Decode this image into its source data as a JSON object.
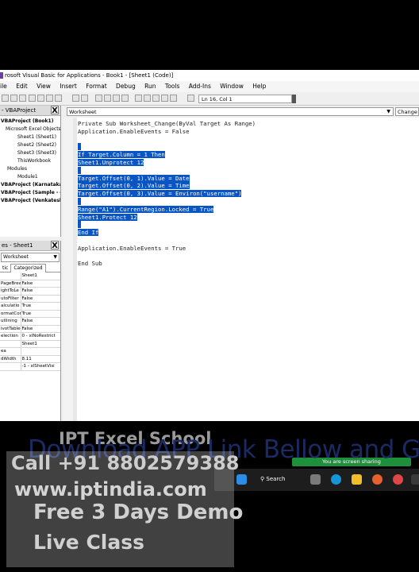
{
  "window": {
    "title": "rosoft Visual Basic for Applications - Book1 - [Sheet1 (Code)]",
    "menu": [
      "ile",
      "Edit",
      "View",
      "Insert",
      "Format",
      "Debug",
      "Run",
      "Tools",
      "Add-Ins",
      "Window",
      "Help"
    ],
    "position": "Ln 16, Col 1"
  },
  "project": {
    "title": "- VBAProject",
    "close": "X",
    "tree": [
      "VBAProject (Book1)",
      "Microsoft Excel Objects",
      "Sheet1 (Sheet1)",
      "Sheet2 (Sheet2)",
      "Sheet3 (Sheet3)",
      "ThisWorkbook",
      "Modules",
      "Module1",
      "VBAProject (Karnataka",
      "VBAProject (Sample - d",
      "VBAProject (Venkatesh"
    ]
  },
  "properties": {
    "title": "es - Sheet1",
    "close": "X",
    "object": "Worksheet",
    "tabs": [
      "tic",
      "Categorized"
    ],
    "rows": [
      [
        "",
        "Sheet1"
      ],
      [
        "PageBreak",
        "False"
      ],
      [
        "ightToLe",
        "False"
      ],
      [
        "utoFilter",
        "False"
      ],
      [
        "alculatio",
        "True"
      ],
      [
        "ormatCor",
        "True"
      ],
      [
        "utlining",
        "False"
      ],
      [
        "ivotTable",
        "False"
      ],
      [
        "election",
        "0 - xlNoRestrict"
      ],
      [
        "",
        "Sheet1"
      ],
      [
        "ea",
        ""
      ],
      [
        "dWidth",
        "8.11"
      ],
      [
        "",
        "-1 - xlSheetVisi"
      ]
    ]
  },
  "editor": {
    "object": "Worksheet",
    "procedure": "Change",
    "lines": [
      {
        "text": "Private Sub Worksheet_Change(ByVal Target As Range)",
        "sel": false
      },
      {
        "text": "Application.EnableEvents = False",
        "sel": false
      },
      {
        "text": "",
        "sel": false
      },
      {
        "text": " ",
        "sel": true
      },
      {
        "text": "If Target.Column = 1 Then",
        "sel": true
      },
      {
        "text": "Sheet1.Unprotect 12",
        "sel": true
      },
      {
        "text": " ",
        "sel": true
      },
      {
        "text": "Target.Offset(0, 1).Value = Date",
        "sel": true
      },
      {
        "text": "Target.Offset(0, 2).Value = Time",
        "sel": true
      },
      {
        "text": "Target.Offset(0, 3).Value = Environ(\"username\")",
        "sel": true
      },
      {
        "text": " ",
        "sel": true
      },
      {
        "text": "Range(\"A1\").CurrentRegion.Locked = True",
        "sel": true
      },
      {
        "text": "Sheet1.Protect 12",
        "sel": true
      },
      {
        "text": " ",
        "sel": true
      },
      {
        "text": "End If",
        "sel": true
      },
      {
        "text": "",
        "sel": false
      },
      {
        "text": "Application.EnableEvents = True",
        "sel": false
      },
      {
        "text": "",
        "sel": false
      },
      {
        "text": "End Sub",
        "sel": false
      }
    ]
  },
  "taskbar": {
    "search": "Search",
    "sharing": "You are screen sharing"
  },
  "overlay": {
    "banner": "Download APP Link Bellow and G",
    "wm_school": "IPT Excel School",
    "wm_call": "Call +91 8802579388",
    "wm_site": "www.iptindia.com",
    "wm_demo": "Free 3 Days Demo",
    "wm_live": "Live Class"
  },
  "colors": {
    "selection": "#0a55c4",
    "banner": "#1b2a63",
    "sharing": "#1e8f3a"
  }
}
